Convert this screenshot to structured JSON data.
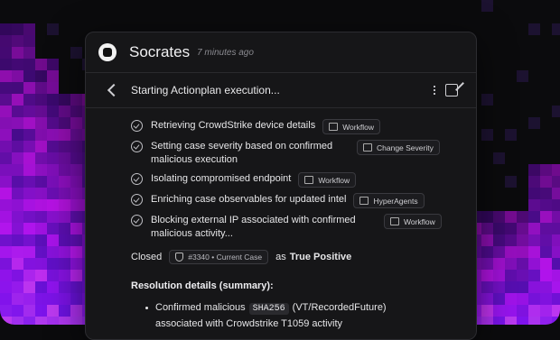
{
  "header": {
    "title": "Socrates",
    "time": "7 minutes ago"
  },
  "subheader": {
    "title": "Starting Actionplan execution..."
  },
  "steps": [
    {
      "text": "Retrieving CrowdStrike device details",
      "tag": "Workflow"
    },
    {
      "text": "Setting case severity based on confirmed malicious execution",
      "tag": "Change Severity"
    },
    {
      "text": "Isolating compromised endpoint",
      "tag": "Workflow"
    },
    {
      "text": "Enriching case observables for updated intel",
      "tag": "HyperAgents"
    },
    {
      "text": "Blocking external IP associated with confirmed malicious activity...",
      "tag": "Workflow"
    }
  ],
  "closed": {
    "label": "Closed",
    "case": "#3340 • Current Case",
    "as": "as",
    "verdict": "True Positive"
  },
  "resolution": {
    "heading": "Resolution details (summary):",
    "items": [
      {
        "pre": "Confirmed malicious",
        "code": "SHA256",
        "post": "(VT/RecordedFuture) associated with Crowdstrike T1059 activity"
      }
    ]
  },
  "colors": {
    "accent": "#8b3dff",
    "panel": "#161618"
  }
}
